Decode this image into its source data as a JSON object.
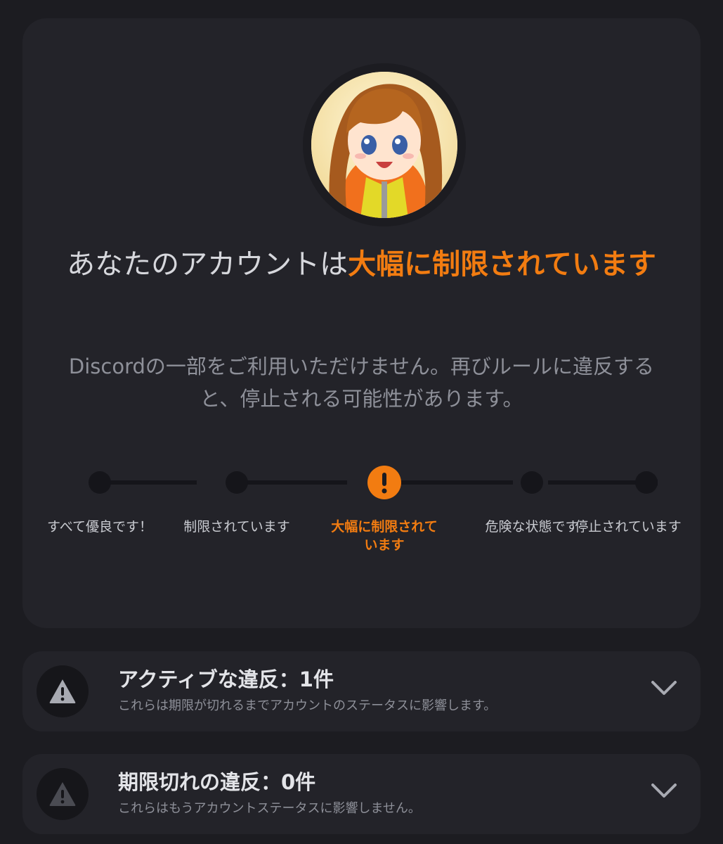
{
  "status": {
    "headline_prefix": "あなたのアカウントは",
    "headline_accent": "大幅に制限されています",
    "description": "Discordの一部をご利用いただけません。再びルールに違反すると、停止される可能性があります。",
    "avatar_icon": "anime-girl-avatar",
    "accent_color": "#f27c11"
  },
  "steps": [
    {
      "label": "すべて優良です！",
      "active": false
    },
    {
      "label": "制限されています",
      "active": false
    },
    {
      "label": "大幅に制限されています",
      "active": true
    },
    {
      "label": "危険な状態です",
      "active": false
    },
    {
      "label": "停止されています",
      "active": false
    }
  ],
  "active_step_icon": "exclamation-icon",
  "violations": [
    {
      "title": "アクティブな違反：1件",
      "description": "これらは期限が切れるまでアカウントのステータスに影響します。",
      "icon": "warning-icon"
    },
    {
      "title": "期限切れの違反：0件",
      "description": "これらはもうアカウントステータスに影響しません。",
      "icon": "warning-icon"
    }
  ]
}
